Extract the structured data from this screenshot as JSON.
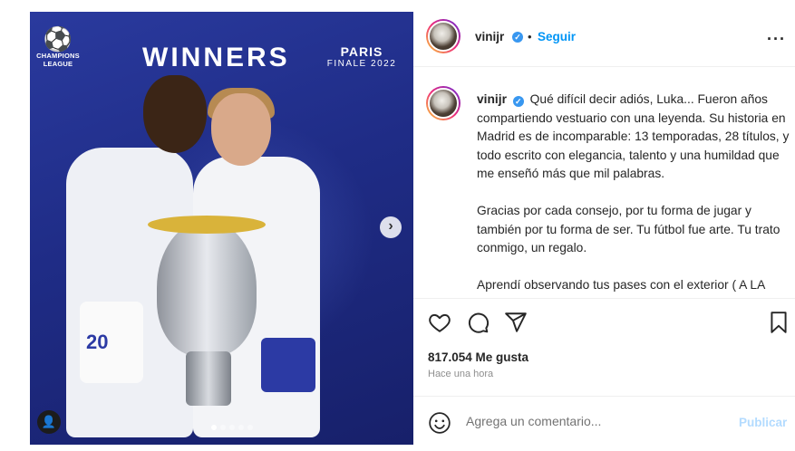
{
  "media": {
    "ucl_logo_line1": "CHAMPIONS",
    "ucl_logo_line2": "LEAGUE",
    "headline": "WINNERS",
    "city": "PARIS",
    "event": "FINALE 2022",
    "shirt_number": "20",
    "carousel_dots": 5,
    "active_dot": 1
  },
  "header": {
    "username": "vinijr",
    "verified": "✓",
    "separator": "•",
    "follow_label": "Seguir",
    "more_label": "···"
  },
  "caption": {
    "username": "vinijr",
    "verified": "✓",
    "paragraph1": "Qué difícil decir adiós, Luka... Fueron años compartiendo vestuario con una leyenda. Su historia en Madrid es de incomparable: 13 temporadas, 28 títulos, y todo escrito con elegancia, talento y una humildad que me enseñó más que mil palabras.",
    "paragraph2": "Gracias por cada consejo, por tu forma de jugar y también por tu forma de ser. Tu fútbol fue arte. Tu trato conmigo, un regalo.",
    "paragraph3": "Aprendí observando tus pases con el exterior ( A LA"
  },
  "stats": {
    "likes": "817.054 Me gusta",
    "time": "Hace una hora"
  },
  "comment": {
    "placeholder": "Agrega un comentario...",
    "publish_label": "Publicar"
  },
  "colors": {
    "accent": "#0095f6",
    "verified": "#3897f0",
    "publish_disabled": "#b3dbff",
    "media_background": "#1f2c86"
  }
}
